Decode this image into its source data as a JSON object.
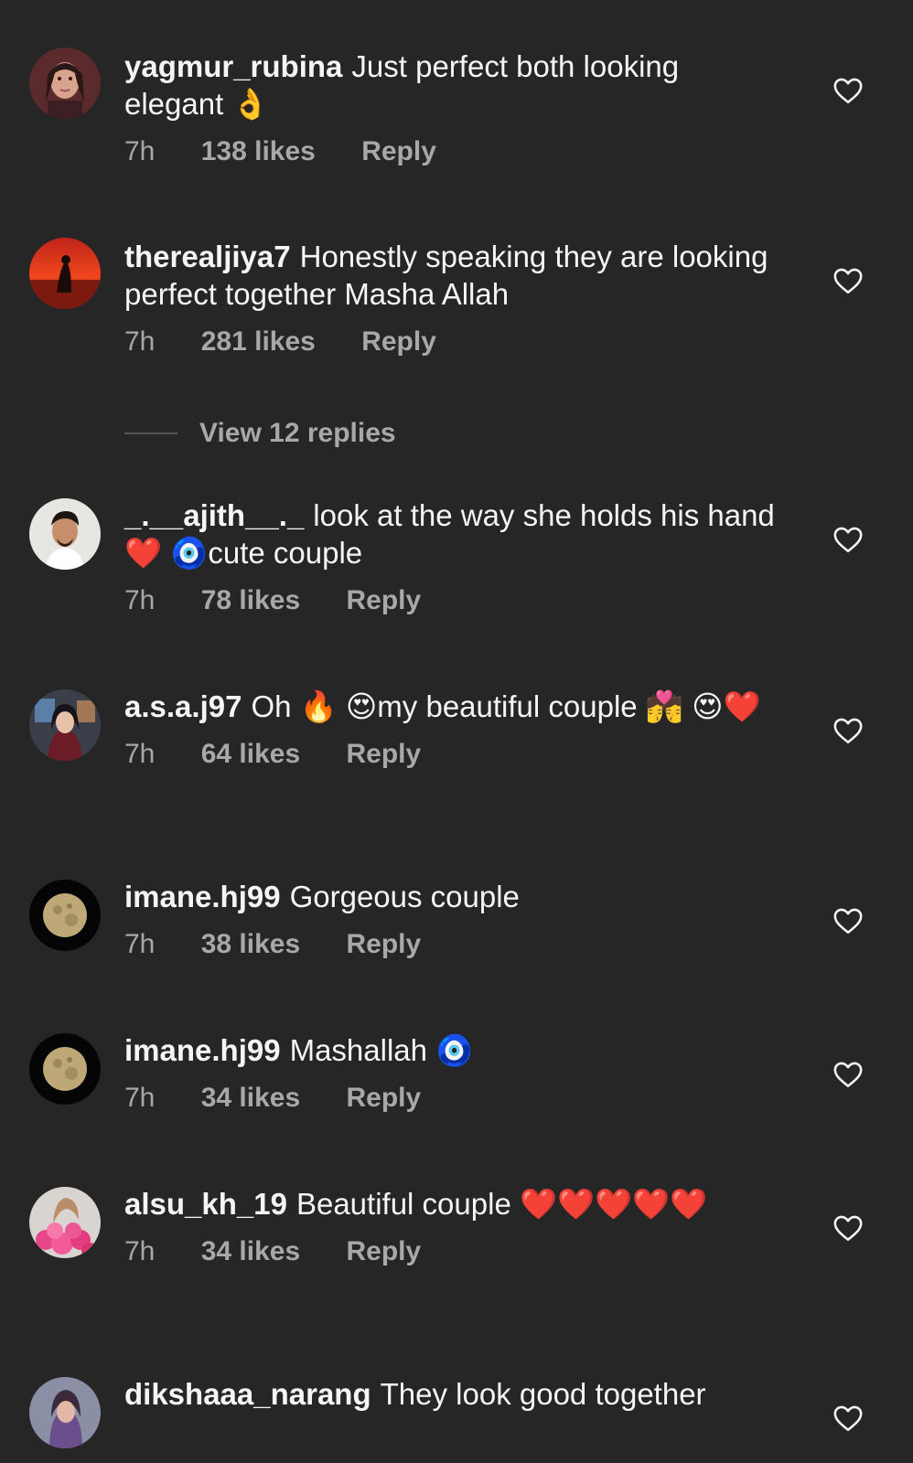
{
  "comments": [
    {
      "username": "yagmur_rubina",
      "text": "Just perfect both looking elegant 👌",
      "time": "7h",
      "likes": "138 likes",
      "reply": "Reply"
    },
    {
      "username": "therealjiya7",
      "text": "Honestly speaking they are looking perfect together Masha Allah",
      "time": "7h",
      "likes": "281 likes",
      "reply": "Reply"
    },
    {
      "username": "_.__ajith__._",
      "text": "look at the way she holds his hand❤️ 🧿cute couple",
      "time": "7h",
      "likes": "78 likes",
      "reply": "Reply"
    },
    {
      "username": "a.s.a.j97",
      "text": "Oh 🔥 😍my beautiful couple 💏 😍❤️",
      "time": "7h",
      "likes": "64 likes",
      "reply": "Reply"
    },
    {
      "username": "imane.hj99",
      "text": "Gorgeous couple",
      "time": "7h",
      "likes": "38 likes",
      "reply": "Reply"
    },
    {
      "username": "imane.hj99",
      "text": "Mashallah 🧿",
      "time": "7h",
      "likes": "34 likes",
      "reply": "Reply"
    },
    {
      "username": "alsu_kh_19",
      "text": "Beautiful couple ❤️❤️❤️❤️❤️",
      "time": "7h",
      "likes": "34 likes",
      "reply": "Reply"
    },
    {
      "username": "dikshaaa_narang",
      "text": "They look good together"
    }
  ],
  "view_replies": "View 12 replies",
  "icons": {
    "like": "heart-outline-icon"
  },
  "colors": {
    "background": "#262626",
    "text": "#f5f5f5",
    "secondary": "#a8a8a8"
  }
}
